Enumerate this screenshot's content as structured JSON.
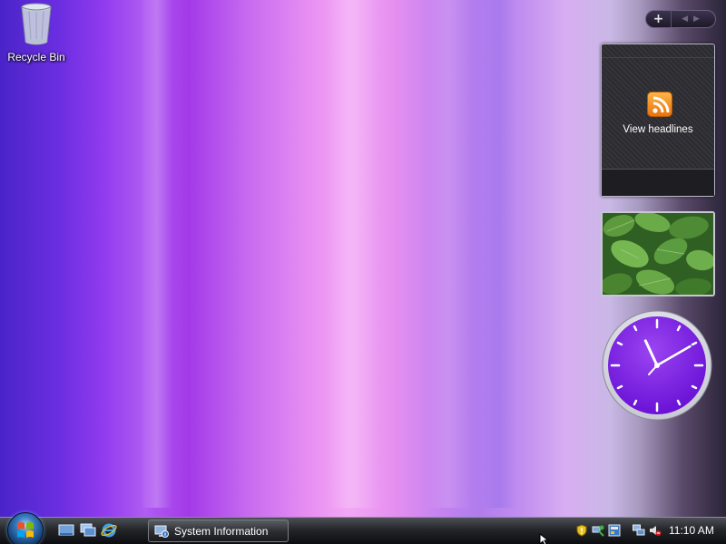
{
  "desktop": {
    "icons": [
      {
        "label": "Recycle Bin",
        "icon": "recycle-bin-icon"
      }
    ]
  },
  "sidebar": {
    "controls": {
      "add_label": "+",
      "prev_icon": "chevron-left-icon",
      "next_icon": "chevron-right-icon"
    },
    "feed_gadget": {
      "title": "View headlines",
      "icon": "rss-icon",
      "accent": "#f08a1c"
    },
    "slideshow_gadget": {
      "image": "green-leaves-photo"
    },
    "clock_gadget": {
      "face_color": "#7b1fe0",
      "hour": 11,
      "minute": 10
    }
  },
  "taskbar": {
    "start_icon": "windows-start-orb",
    "quick_launch": [
      {
        "name": "show-desktop-icon"
      },
      {
        "name": "switch-windows-icon"
      },
      {
        "name": "internet-explorer-icon"
      }
    ],
    "open_windows": [
      {
        "label": "System Information",
        "icon": "system-information-icon"
      }
    ],
    "tray": {
      "icons": [
        "security-shield-icon",
        "network-status-icon",
        "windows-update-icon",
        "network-icon",
        "volume-muted-icon"
      ],
      "clock": "11:10 AM"
    }
  }
}
